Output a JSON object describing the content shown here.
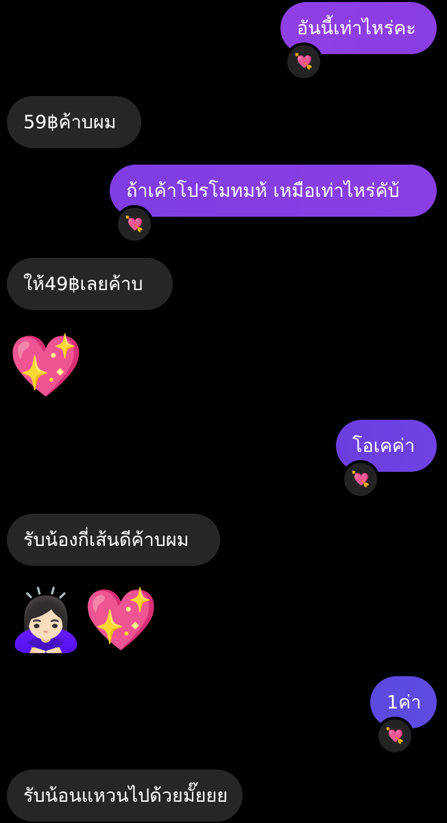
{
  "messages": [
    {
      "direction": "outgoing",
      "text": "อันนี้เท่าไหร่คะ",
      "reaction": "💘"
    },
    {
      "direction": "incoming",
      "text": "59฿ค้าบผม"
    },
    {
      "direction": "outgoing",
      "text": "ถ้าเค้าโปรโมทมห้ เหมือเท่าไหร่คับ้",
      "reaction": "💘"
    },
    {
      "direction": "incoming",
      "text": "ให้49฿เลยค้าบ"
    },
    {
      "direction": "incoming",
      "emoji": "💖"
    },
    {
      "direction": "outgoing",
      "text": "โอเคค่า",
      "reaction": "💘"
    },
    {
      "direction": "incoming",
      "text": "รับน้องกี่เส้นดีค้าบผม"
    },
    {
      "direction": "incoming",
      "emoji": "🙇🏻‍♀️💖"
    },
    {
      "direction": "outgoing",
      "text": "1ค่า",
      "reaction": "💘"
    },
    {
      "direction": "incoming",
      "text": "รับน้อนแหวนไปด้วยมั๊ยยย"
    }
  ],
  "colors": {
    "background": "#000000",
    "incoming_bubble": "#262626",
    "outgoing_gradient_top": "#8f3fe6",
    "outgoing_gradient_bottom": "#5b4ae0",
    "text": "#ffffff"
  }
}
